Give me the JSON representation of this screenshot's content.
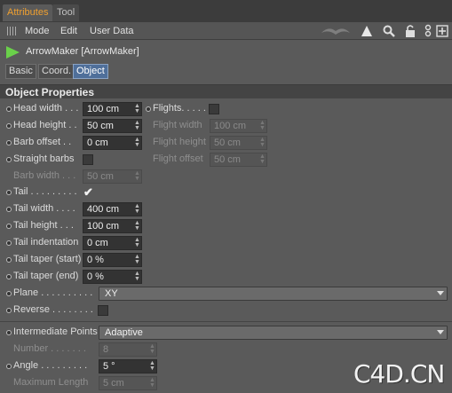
{
  "tabs": {
    "attributes": "Attributes",
    "tool": "Tool"
  },
  "menu": {
    "mode": "Mode",
    "edit": "Edit",
    "user_data": "User Data"
  },
  "object": {
    "title": "ArrowMaker [ArrowMaker]"
  },
  "subtabs": {
    "basic": "Basic",
    "coord": "Coord.",
    "object": "Object"
  },
  "section": {
    "title": "Object Properties"
  },
  "props": {
    "head_width": {
      "label": "Head width . . .",
      "value": "100 cm"
    },
    "head_height": {
      "label": "Head height . .",
      "value": "50 cm"
    },
    "barb_offset": {
      "label": "Barb offset . .",
      "value": "0 cm"
    },
    "straight_barbs": {
      "label": "Straight barbs"
    },
    "barb_width": {
      "label": "Barb width . . .",
      "value": "50 cm"
    },
    "tail": {
      "label": "Tail . . . . . . . . .",
      "checked": true
    },
    "tail_width": {
      "label": "Tail width . . . .",
      "value": "400 cm"
    },
    "tail_height": {
      "label": "Tail height . . .",
      "value": "100 cm"
    },
    "tail_indentation": {
      "label": "Tail indentation",
      "value": "0 cm"
    },
    "tail_taper_start": {
      "label": "Tail taper (start)",
      "value": "0 %"
    },
    "tail_taper_end": {
      "label": "Tail taper (end)",
      "value": "0 %"
    },
    "plane": {
      "label": "Plane . . . . . . . . . .",
      "value": "XY"
    },
    "reverse": {
      "label": "Reverse . . . . . . . ."
    },
    "intermediate_points": {
      "label": "Intermediate Points",
      "value": "Adaptive"
    },
    "number": {
      "label": "Number . . . . . . .",
      "value": "8"
    },
    "angle": {
      "label": "Angle . . . . . . . . .",
      "value": "5 °"
    },
    "maximum_length": {
      "label": "Maximum Length",
      "value": "5 cm"
    },
    "flights": {
      "label": "Flights. . . . ."
    },
    "flight_width": {
      "label": "Flight width",
      "value": "100 cm"
    },
    "flight_height": {
      "label": "Flight height",
      "value": "50 cm"
    },
    "flight_offset": {
      "label": "Flight offset",
      "value": "50 cm"
    }
  },
  "watermark": "C4D.CN",
  "colors": {
    "accent": "#f0a030",
    "object_icon": "#6ad04a",
    "active_tab": "#4f6f9a"
  }
}
